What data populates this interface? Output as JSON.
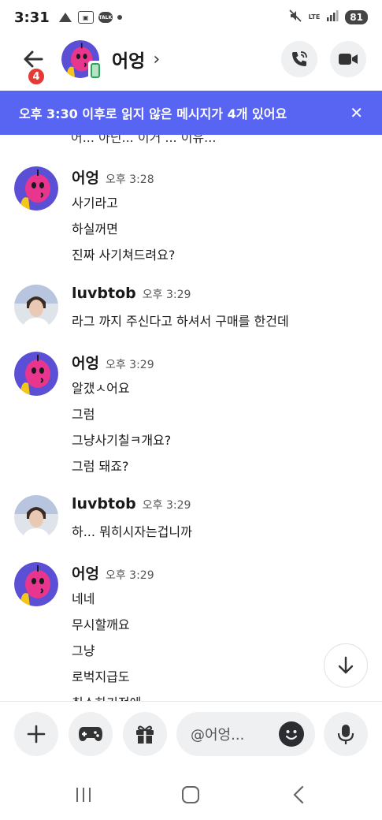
{
  "status_bar": {
    "time": "3:31",
    "talk_label": "TALK",
    "network": "LTE",
    "battery": "81"
  },
  "header": {
    "back_badge": "4",
    "title": "어엉",
    "chevron": "›"
  },
  "banner": {
    "text": "오후 3:30 이후로 읽지 않은 메시지가 4개 있어요",
    "close": "✕"
  },
  "messages": {
    "clipped_line": "어... 아닌... 이거 ... 이유...",
    "groups": [
      {
        "author": "어엉",
        "time": "오후 3:28",
        "lines": [
          "사기라고",
          "하실꺼면",
          "진짜 사기쳐드려요?"
        ]
      },
      {
        "author": "luvbtob",
        "time": "오후 3:29",
        "lines": [
          "라그 까지 주신다고 하셔서  구매를 한건데"
        ]
      },
      {
        "author": "어엉",
        "time": "오후 3:29",
        "lines": [
          "알갰ㅅ어요",
          "그럼",
          "그냥사기칠ㅋ개요?",
          "그럼 돼죠?"
        ]
      },
      {
        "author": "luvbtob",
        "time": "오후 3:29",
        "lines": [
          "하... 뭐히시자는겁니까"
        ]
      },
      {
        "author": "어엉",
        "time": "오후 3:29",
        "lines": [
          "네네",
          "무시할깨요",
          "그냥",
          "로벅지급도",
          "취소하기전에"
        ]
      }
    ]
  },
  "composer": {
    "placeholder": "@어엉..."
  },
  "icons": {
    "back": "arrow-left-icon",
    "voice_call": "phone-icon",
    "video_call": "video-camera-icon",
    "add": "plus-icon",
    "games": "gamepad-icon",
    "gift": "gift-icon",
    "emoji": "emoji-icon",
    "mic": "microphone-icon",
    "scroll_down": "arrow-down-icon"
  },
  "colors": {
    "banner": "#5865f2",
    "badge": "#e53935",
    "button_bg": "#eef0f2",
    "avatar_purple": "#5b4fd6",
    "avatar_pink": "#e8368f"
  }
}
